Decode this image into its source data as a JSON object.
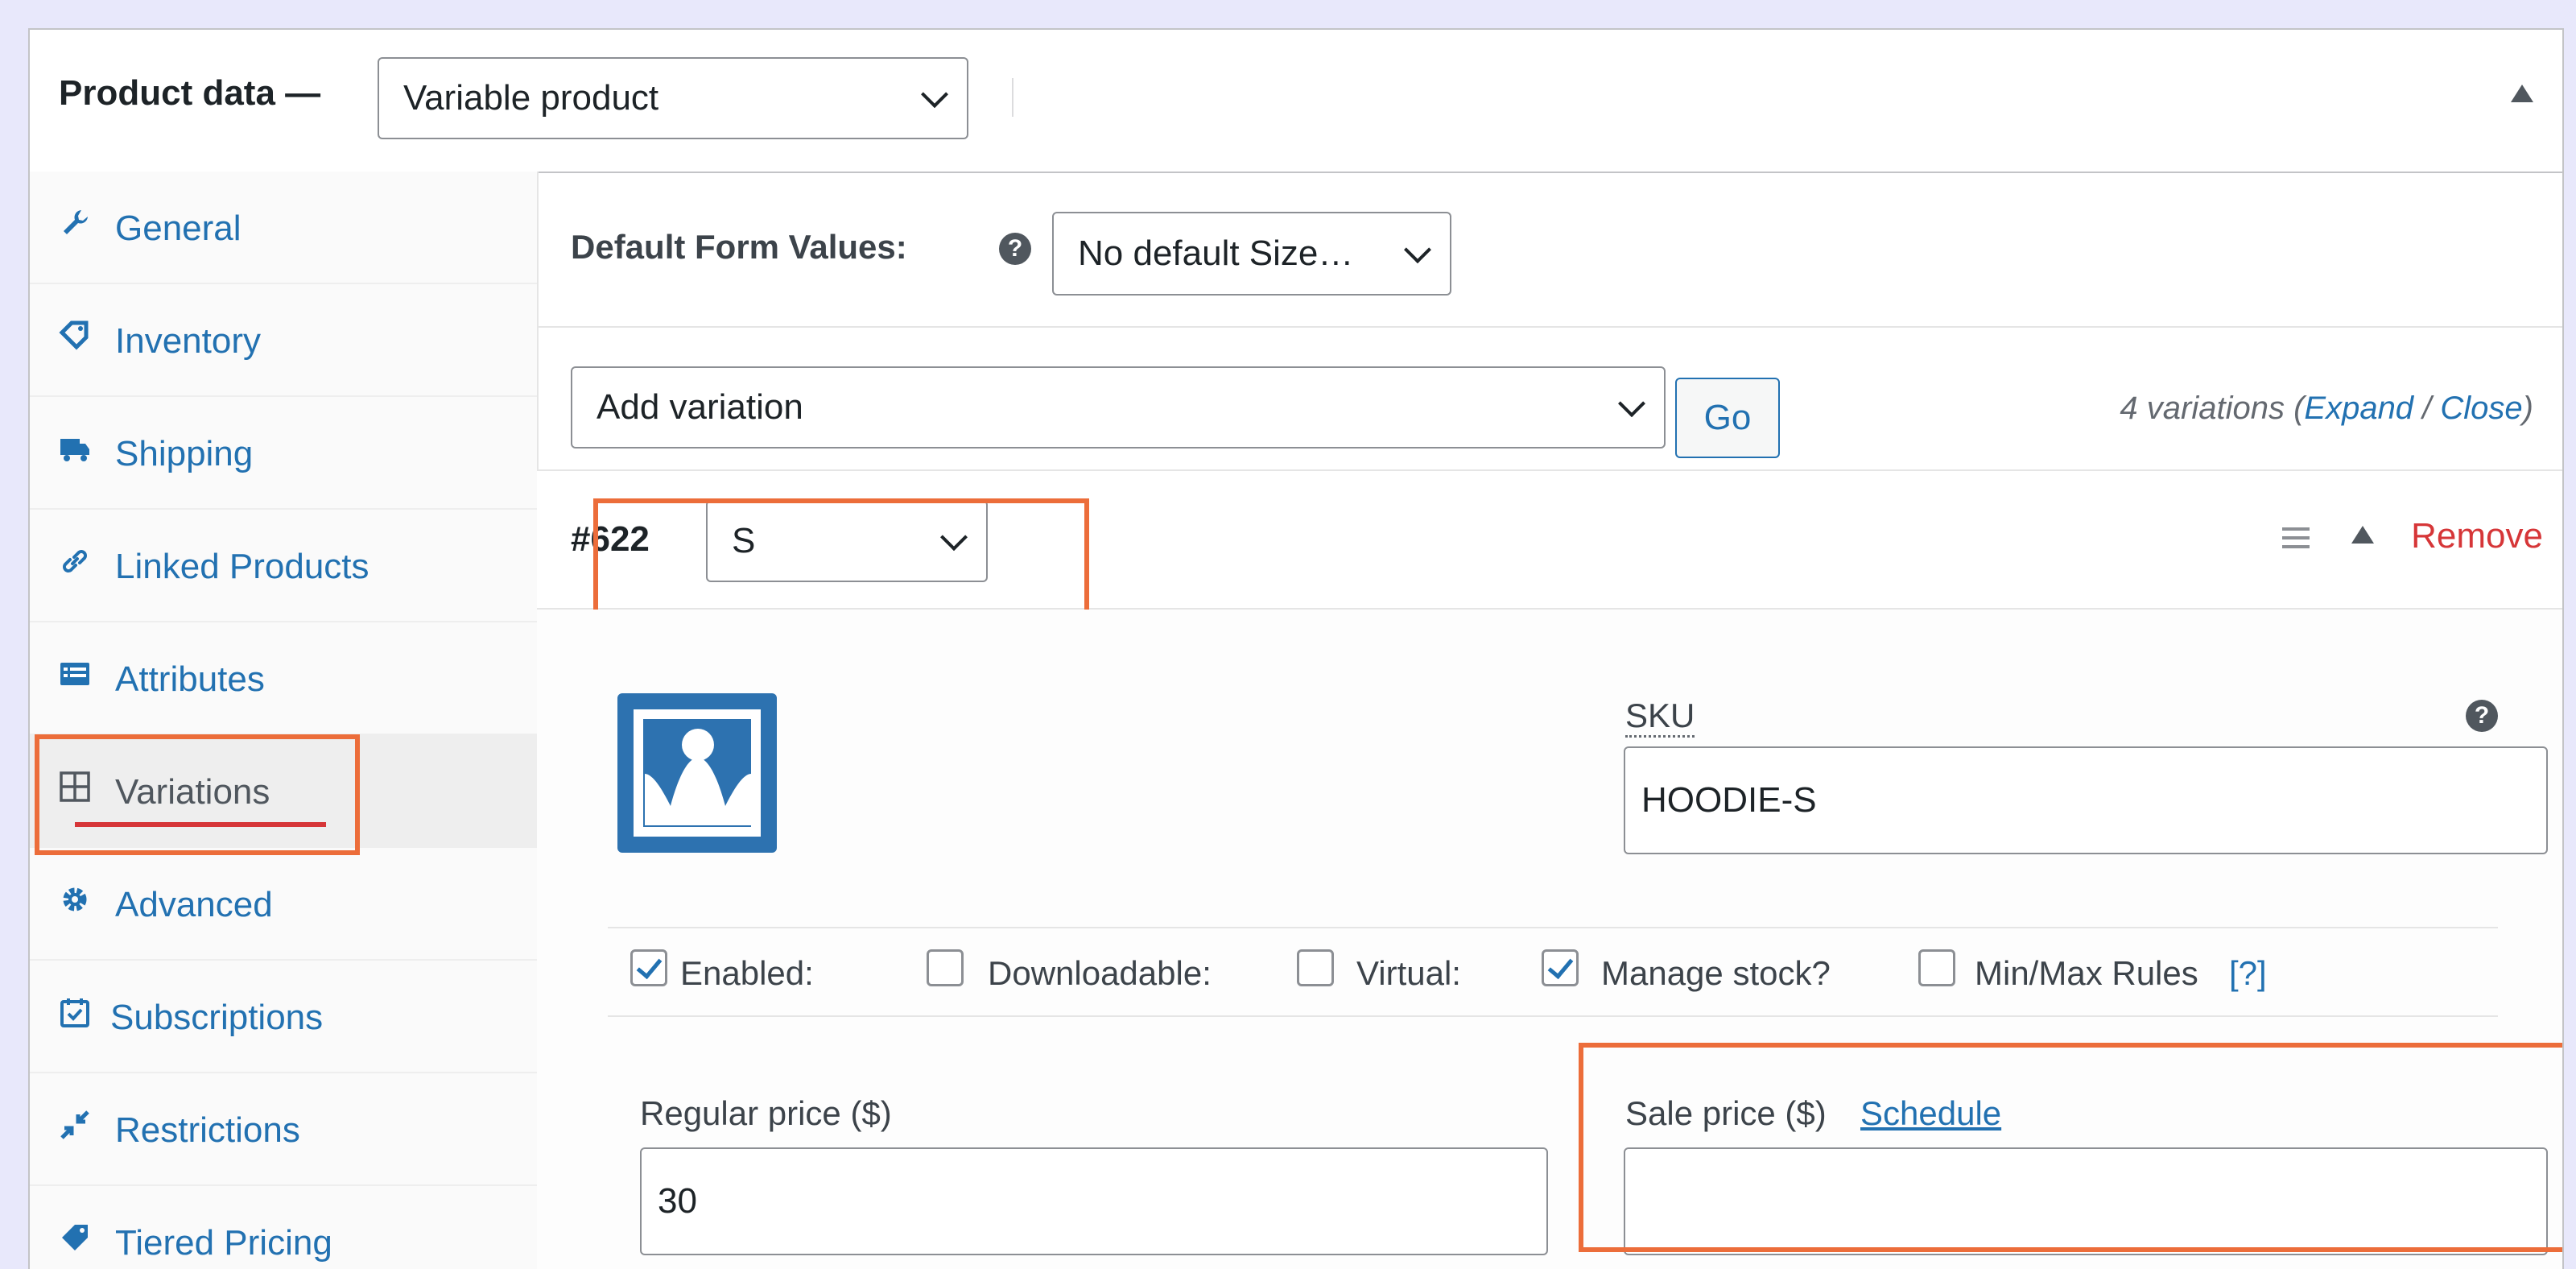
{
  "header": {
    "title": "Product data —",
    "product_type": "Variable product"
  },
  "sidebar": {
    "items": [
      {
        "label": "General",
        "icon": "wrench-icon"
      },
      {
        "label": "Inventory",
        "icon": "tag-icon"
      },
      {
        "label": "Shipping",
        "icon": "truck-icon"
      },
      {
        "label": "Linked Products",
        "icon": "link-icon"
      },
      {
        "label": "Attributes",
        "icon": "list-icon"
      },
      {
        "label": "Variations",
        "icon": "grid-icon",
        "active": true
      },
      {
        "label": "Advanced",
        "icon": "gear-icon"
      },
      {
        "label": "Subscriptions",
        "icon": "calendar-icon"
      },
      {
        "label": "Restrictions",
        "icon": "compress-icon"
      },
      {
        "label": "Tiered Pricing",
        "icon": "tag-icon"
      }
    ]
  },
  "main": {
    "default_form_values_label": "Default Form Values:",
    "default_size_select": "No default Size…",
    "add_variation_select": "Add variation",
    "go_button": "Go",
    "variations_count": "4 variations (",
    "expand_link": "Expand",
    "slash": " / ",
    "close_link": "Close",
    "close_paren": ")",
    "variation": {
      "id": "#622",
      "size": "S",
      "remove_label": "Remove",
      "sku_label": "SKU",
      "sku_value": "HOODIE-S",
      "checkboxes": [
        {
          "label": "Enabled:",
          "checked": true
        },
        {
          "label": "Downloadable:",
          "checked": false
        },
        {
          "label": "Virtual:",
          "checked": false
        },
        {
          "label": "Manage stock?",
          "checked": true
        },
        {
          "label": "Min/Max Rules",
          "checked": false
        }
      ],
      "minmax_help": "[?]",
      "regular_price_label": "Regular price ($)",
      "regular_price_value": "30",
      "sale_price_label": "Sale price ($)",
      "schedule_link": "Schedule",
      "sale_price_value": ""
    }
  },
  "colors": {
    "link": "#2271b1",
    "remove": "#d63638",
    "highlight": "#ec6d3a",
    "underline": "#d63638"
  }
}
